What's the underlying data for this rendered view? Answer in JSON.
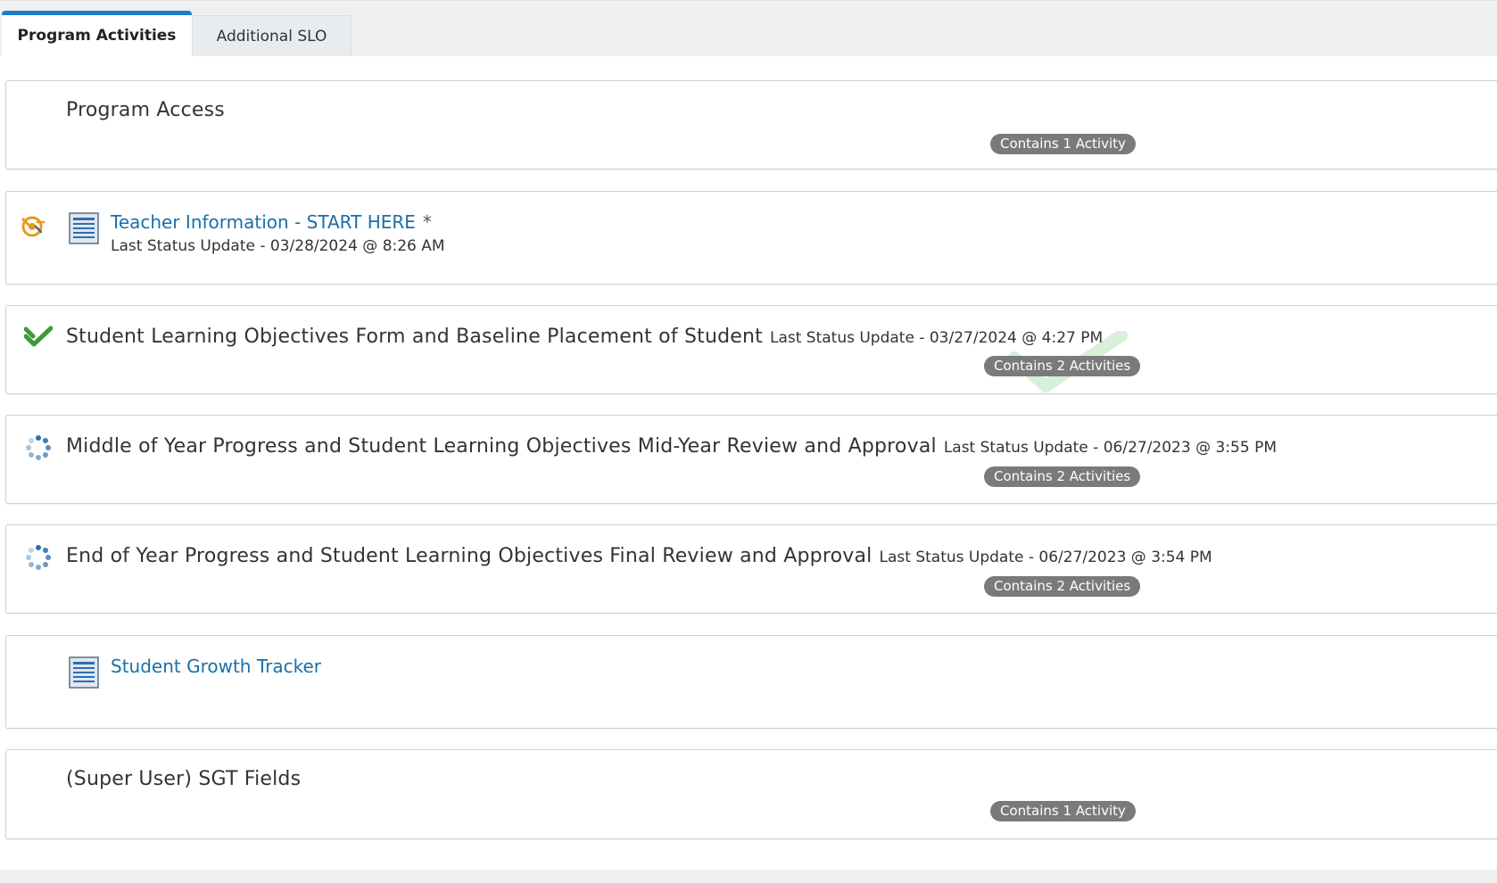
{
  "tabs": [
    {
      "label": "Program Activities"
    },
    {
      "label": "Additional SLO"
    }
  ],
  "rows": [
    {
      "title": "Program Access",
      "badge": "Contains 1 Activity"
    },
    {
      "title": "Teacher Information - START HERE",
      "status": "Last Status Update - 03/28/2024 @ 8:26 AM",
      "required_mark": "*",
      "icon": "in-progress-icon"
    },
    {
      "title": "Student Learning Objectives Form and Baseline Placement of Student",
      "status": "Last Status Update - 03/27/2024 @ 4:27 PM",
      "badge": "Contains 2 Activities",
      "icon": "complete-checkmark-icon"
    },
    {
      "title": "Middle of Year Progress and Student Learning Objectives Mid-Year Review and Approval",
      "status": "Last Status Update - 06/27/2023 @ 3:55 PM",
      "badge": "Contains 2 Activities",
      "icon": "loading-spinner-icon"
    },
    {
      "title": "End of Year Progress and Student Learning Objectives Final Review and Approval",
      "status": "Last Status Update - 06/27/2023 @ 3:54 PM",
      "badge": "Contains 2 Activities",
      "icon": "loading-spinner-icon"
    },
    {
      "title": "Student Growth Tracker",
      "icon": "document-icon"
    },
    {
      "title": "(Super User) SGT Fields",
      "badge": "Contains 1 Activity"
    }
  ],
  "colors": {
    "accent": "#1e7fc8",
    "link": "#1a6fa8",
    "badge": "#7a7a7a",
    "complete": "#3a9b3a",
    "in_progress": "#e69a1f",
    "spinner": "#2e6fa6"
  }
}
